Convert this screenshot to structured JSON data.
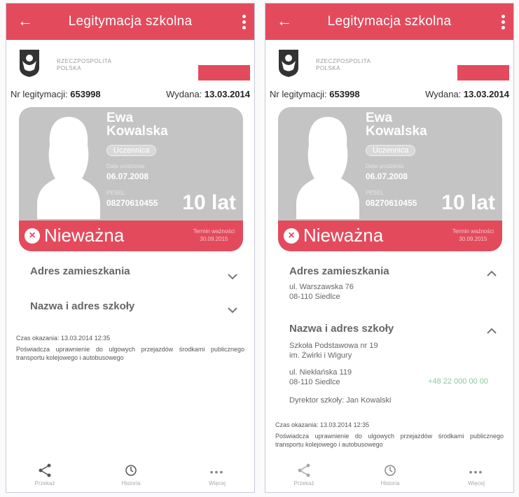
{
  "app": {
    "title": "Legitymacja szkolna"
  },
  "header": {
    "country_line1": "RZECZPOSPOLITA",
    "country_line2": "POLSKA"
  },
  "ids": {
    "number_label": "Nr legitymacji:",
    "number_value": "653998",
    "issued_label": "Wydana:",
    "issued_value": "13.03.2014"
  },
  "card": {
    "first_name": "Ewa",
    "last_name": "Kowalska",
    "role": "Uczennica",
    "dob_label": "Data urodzenia",
    "dob_value": "06.07.2008",
    "pesel_label": "PESEL",
    "pesel_value": "08270610455",
    "age": "10 lat",
    "status": "Nieważna",
    "validity_label": "Termin ważności",
    "validity_value": "30.09.2015"
  },
  "sections": {
    "address_title": "Adres zamieszkania",
    "address_line1": "ul. Warszawska 76",
    "address_line2": "08-110 Siedlce",
    "school_title": "Nazwa i adres szkoły",
    "school_name1": "Szkoła Podstawowa nr 19",
    "school_name2": "im. Żwirki i Wigury",
    "school_street": "ul. Niekłańska 119",
    "school_city": "08-110 Siedlce",
    "school_phone": "+48 22 000 00 00",
    "director": "Dyrektor szkoły: Jan Kowalski"
  },
  "footer": {
    "shown_time": "Czas okazania: 13.03.2014 12:35",
    "description": "Poświadcza uprawnienie do ulgowych przejazdów środkami publicznego transportu kolejowego i autobusowego"
  },
  "nav": {
    "share": "Przekaż",
    "history": "Historia",
    "more": "Więcej"
  },
  "colors": {
    "accent": "#e34b5d",
    "card_grey": "#c4c4c4"
  }
}
